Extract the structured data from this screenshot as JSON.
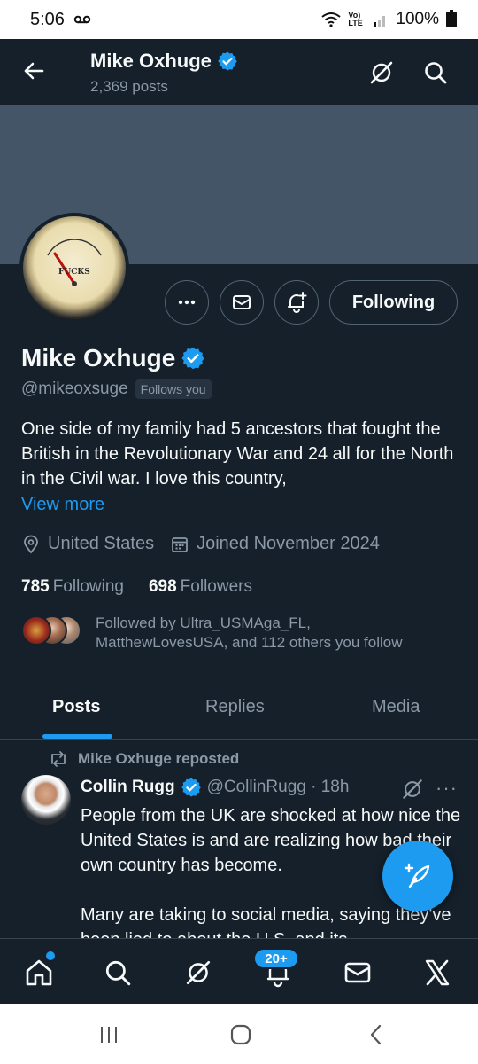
{
  "status_bar": {
    "time": "5:06",
    "network": "Vo) LTE",
    "battery": "100%"
  },
  "header": {
    "title": "Mike Oxhuge",
    "posts_count": "2,369 posts"
  },
  "profile": {
    "name": "Mike Oxhuge",
    "handle": "@mikeoxsuge",
    "follows_you": "Follows you",
    "avatar_gauge_text": "FUCKS",
    "bio": "One side of my family had 5 ancestors that fought the British in the Revolutionary War and 24 all for the North in the Civil war. I love this country,",
    "view_more": "View more",
    "location": "United States",
    "joined": "Joined November 2024",
    "following_count": "785",
    "following_label": "Following",
    "followers_count": "698",
    "followers_label": "Followers",
    "followed_by_line1": "Followed by Ultra_USMAga_FL,",
    "followed_by_line2": "MatthewLovesUSA, and 112 others you follow"
  },
  "actions": {
    "following_button": "Following"
  },
  "tabs": [
    {
      "label": "Posts"
    },
    {
      "label": "Replies"
    },
    {
      "label": "Media"
    }
  ],
  "post": {
    "repost_label": "Mike Oxhuge reposted",
    "author": "Collin Rugg",
    "handle_time": "@CollinRugg · 18h",
    "more": "···",
    "text_p1": "People from the UK are shocked at how nice the United States is and are realizing how bad their own country has become.",
    "text_p2": "Many are taking to social media, saying they've been lied to about the U.S. and its"
  },
  "bottom_nav": {
    "notifications_badge": "20+"
  },
  "colors": {
    "background": "#15202b",
    "accent": "#1d9bf0",
    "muted_text": "#8b98a5",
    "banner": "#435566"
  }
}
